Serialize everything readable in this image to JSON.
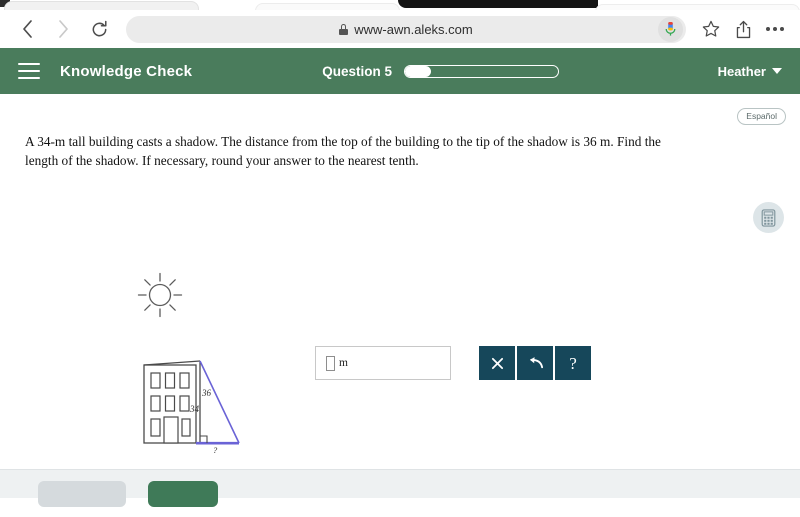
{
  "browser": {
    "back_icon": "back-arrow-icon",
    "forward_icon": "forward-arrow-icon",
    "reload_icon": "reload-icon",
    "url": "www-awn.aleks.com",
    "lock_icon": "lock-icon",
    "mic_icon": "microphone-icon",
    "bookmark_icon": "star-icon",
    "share_icon": "share-icon",
    "more_icon": "more-options-icon"
  },
  "header": {
    "menu_icon": "hamburger-menu-icon",
    "title": "Knowledge Check",
    "question_label": "Question 5",
    "progress_percent": 17,
    "user_name": "Heather",
    "caret_icon": "chevron-down-icon"
  },
  "content": {
    "espanol_label": "Español",
    "question_text": "A 34-m tall building casts a shadow. The distance from the top of the building to the tip of the shadow is 36 m. Find the length of the shadow. If necessary, round your answer to the nearest tenth.",
    "calculator_icon": "calculator-icon",
    "sun_icon": "sun-icon"
  },
  "figure": {
    "building_label": "building-diagram",
    "height_label": "34",
    "hypotenuse_label": "36",
    "shadow_label": "?",
    "shadow_color": "#6a63d6",
    "outline_color": "#4a4a4a",
    "right_angle_marker": "right-angle-icon"
  },
  "answer": {
    "input_value": "",
    "input_placeholder": "",
    "unit": "m",
    "buttons": [
      {
        "name": "clear-button",
        "glyph": "✕"
      },
      {
        "name": "undo-button",
        "glyph": "↶"
      },
      {
        "name": "help-button",
        "glyph": "?"
      }
    ]
  },
  "footer": {
    "secondary_label": "",
    "primary_label": ""
  },
  "colors": {
    "header_green": "#4a7c5c",
    "tool_teal": "#16475a",
    "footer_green": "#3f7a58",
    "shadow_purple": "#6a63d6"
  }
}
